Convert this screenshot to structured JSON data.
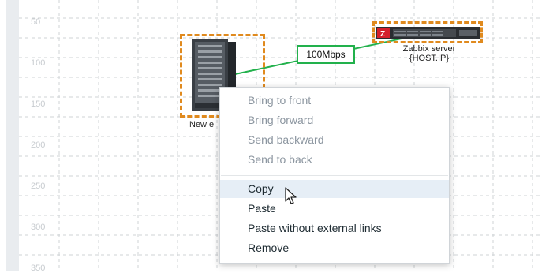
{
  "ruler": {
    "labels": [
      "50",
      "100",
      "150",
      "200",
      "250",
      "300",
      "350"
    ]
  },
  "link": {
    "label": "100Mbps",
    "color": "#22b14c"
  },
  "hosts": {
    "new_host": {
      "label": "New e",
      "icon": "server-tower-icon"
    },
    "zabbix_server": {
      "name": "Zabbix server",
      "ip": "{HOST.IP}",
      "icon": "rack-server-icon"
    }
  },
  "selection_color": "#e08a1e",
  "context_menu": {
    "items": [
      {
        "label": "Bring to front",
        "enabled": false
      },
      {
        "label": "Bring forward",
        "enabled": false
      },
      {
        "label": "Send backward",
        "enabled": false
      },
      {
        "label": "Send to back",
        "enabled": false
      },
      {
        "label": "Copy",
        "enabled": true,
        "hovered": true
      },
      {
        "label": "Paste",
        "enabled": true
      },
      {
        "label": "Paste without external links",
        "enabled": true
      },
      {
        "label": "Remove",
        "enabled": true
      }
    ]
  },
  "cursor_icon": "mouse-pointer-icon"
}
